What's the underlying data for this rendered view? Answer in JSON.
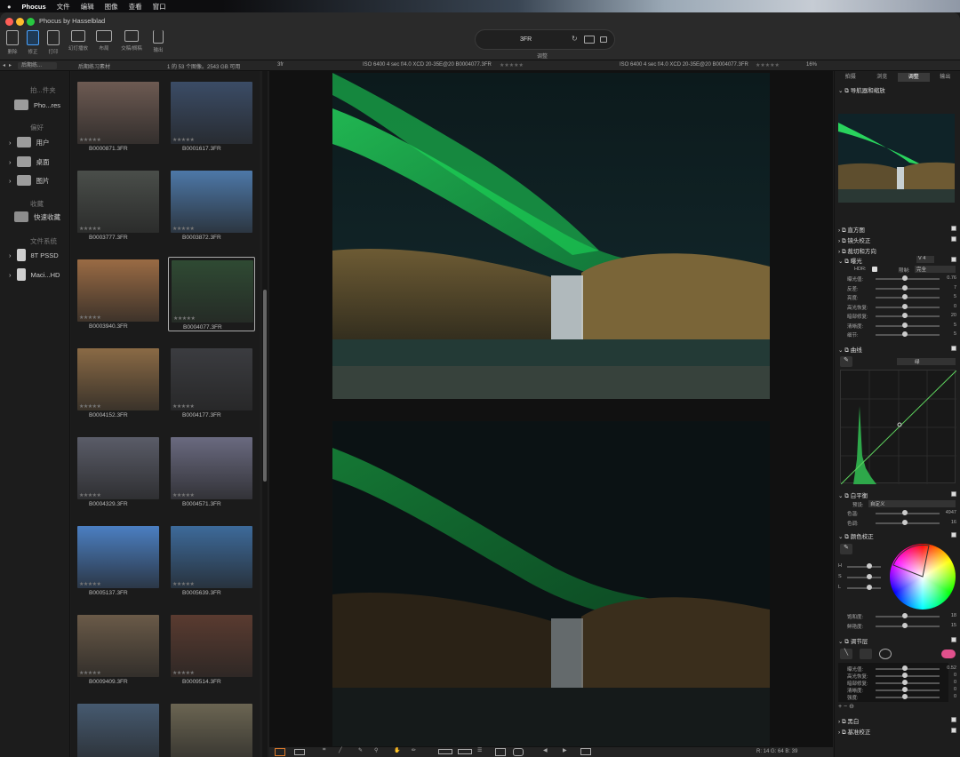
{
  "menubar": {
    "app": "Phocus",
    "items": [
      "文件",
      "编辑",
      "图像",
      "查看",
      "窗口"
    ]
  },
  "window": {
    "title": "Phocus by Hasselblad"
  },
  "toolbar": {
    "buttons": [
      "删除",
      "修正",
      "打印",
      "幻灯播放",
      "布局",
      "交稿/搁稿",
      "输出"
    ],
    "format": "3FR",
    "adjust_label": "调整"
  },
  "subbar": {
    "library_select": "后期练...",
    "folder_name": "后期练习素材",
    "count": "1 的 53 个图像。2543 GB 可用",
    "tag1": "3fr",
    "meta_left": "ISO 6400   4 sec   f/4.0   XCD 20-35E@20   B0004077.3FR",
    "meta_right": "ISO 6400   4 sec   f/4.0   XCD 20-35E@20   B0004077.3FR",
    "zoom": "16%"
  },
  "sidebar": {
    "sections": [
      {
        "header": "拍...件夹",
        "items": [
          "Pho...res"
        ]
      },
      {
        "header": "偏好",
        "items": [
          "用户",
          "桌面",
          "图片"
        ]
      },
      {
        "header": "收藏",
        "items": [
          "快速收藏"
        ]
      },
      {
        "header": "文件系统",
        "items": [
          "8T PSSD",
          "Maci...HD"
        ]
      }
    ]
  },
  "thumbnails": [
    {
      "name": "B0000871.3FR",
      "color": "#6d5a52"
    },
    {
      "name": "B0001617.3FR",
      "color": "#3b4c66"
    },
    {
      "name": "B0003777.3FR",
      "color": "#4a4e4a"
    },
    {
      "name": "B0003872.3FR",
      "color": "#4d78a8"
    },
    {
      "name": "B0003940.3FR",
      "color": "#9a6b44"
    },
    {
      "name": "B0004077.3FR",
      "color": "#2f4a33"
    },
    {
      "name": "B0004152.3FR",
      "color": "#8a6a45"
    },
    {
      "name": "B0004177.3FR",
      "color": "#3b3c40"
    },
    {
      "name": "B0004329.3FR",
      "color": "#5a5c68"
    },
    {
      "name": "B0004571.3FR",
      "color": "#6a6a80"
    },
    {
      "name": "B0005137.3FR",
      "color": "#4b7fc2"
    },
    {
      "name": "B0005639.3FR",
      "color": "#3d6a9a"
    },
    {
      "name": "B0009409.3FR",
      "color": "#6a5a48"
    },
    {
      "name": "B0009514.3FR",
      "color": "#5a3b30"
    },
    {
      "name": "",
      "color": "#465a70"
    },
    {
      "name": "",
      "color": "#6b6552"
    }
  ],
  "viewer": {
    "readout": "R:   14   G:   64   B:   39"
  },
  "right_panel": {
    "tabs": [
      "拍摄",
      "浏览",
      "调整",
      "输出"
    ],
    "active_tab": "调整",
    "navigator": "导航器和缩放",
    "sections_collapsed": [
      "直方图",
      "镜头校正",
      "裁切和方向"
    ],
    "exposure": {
      "title": "曝光",
      "version": "V 4",
      "hdr_label": "HDR:",
      "limit_label": "限制:",
      "limit_value": "完全",
      "rows": [
        {
          "label": "曝光值:",
          "value": "0.76"
        },
        {
          "label": "反差:",
          "value": "7"
        },
        {
          "label": "亮度:",
          "value": "5"
        },
        {
          "label": "高光恢复:",
          "value": "0"
        },
        {
          "label": "暗部修复:",
          "value": "20"
        },
        {
          "label": "清晰度:",
          "value": "5"
        },
        {
          "label": "细节:",
          "value": "5"
        }
      ]
    },
    "curves": {
      "title": "曲线",
      "channel": "绿"
    },
    "white_balance": {
      "title": "白平衡",
      "preset_label": "预设:",
      "preset_value": "自定义",
      "rows": [
        {
          "label": "色温:",
          "value": "4947"
        },
        {
          "label": "色调:",
          "value": "16"
        }
      ]
    },
    "color_correction": {
      "title": "颜色校正",
      "hsl": [
        "H",
        "S",
        "L"
      ],
      "rows": [
        {
          "label": "饱和度:",
          "value": "18"
        },
        {
          "label": "鲜艳度:",
          "value": "15"
        }
      ]
    },
    "adjust_layers": {
      "title": "调节层",
      "rows": [
        {
          "label": "曝光值:",
          "value": "0.52"
        },
        {
          "label": "高光恢复:",
          "value": "0"
        },
        {
          "label": "暗部修复:",
          "value": "0"
        },
        {
          "label": "清晰度:",
          "value": "0"
        },
        {
          "label": "强度:",
          "value": "0"
        }
      ]
    },
    "bottom_sections": [
      "黑白",
      "基准校正"
    ]
  }
}
